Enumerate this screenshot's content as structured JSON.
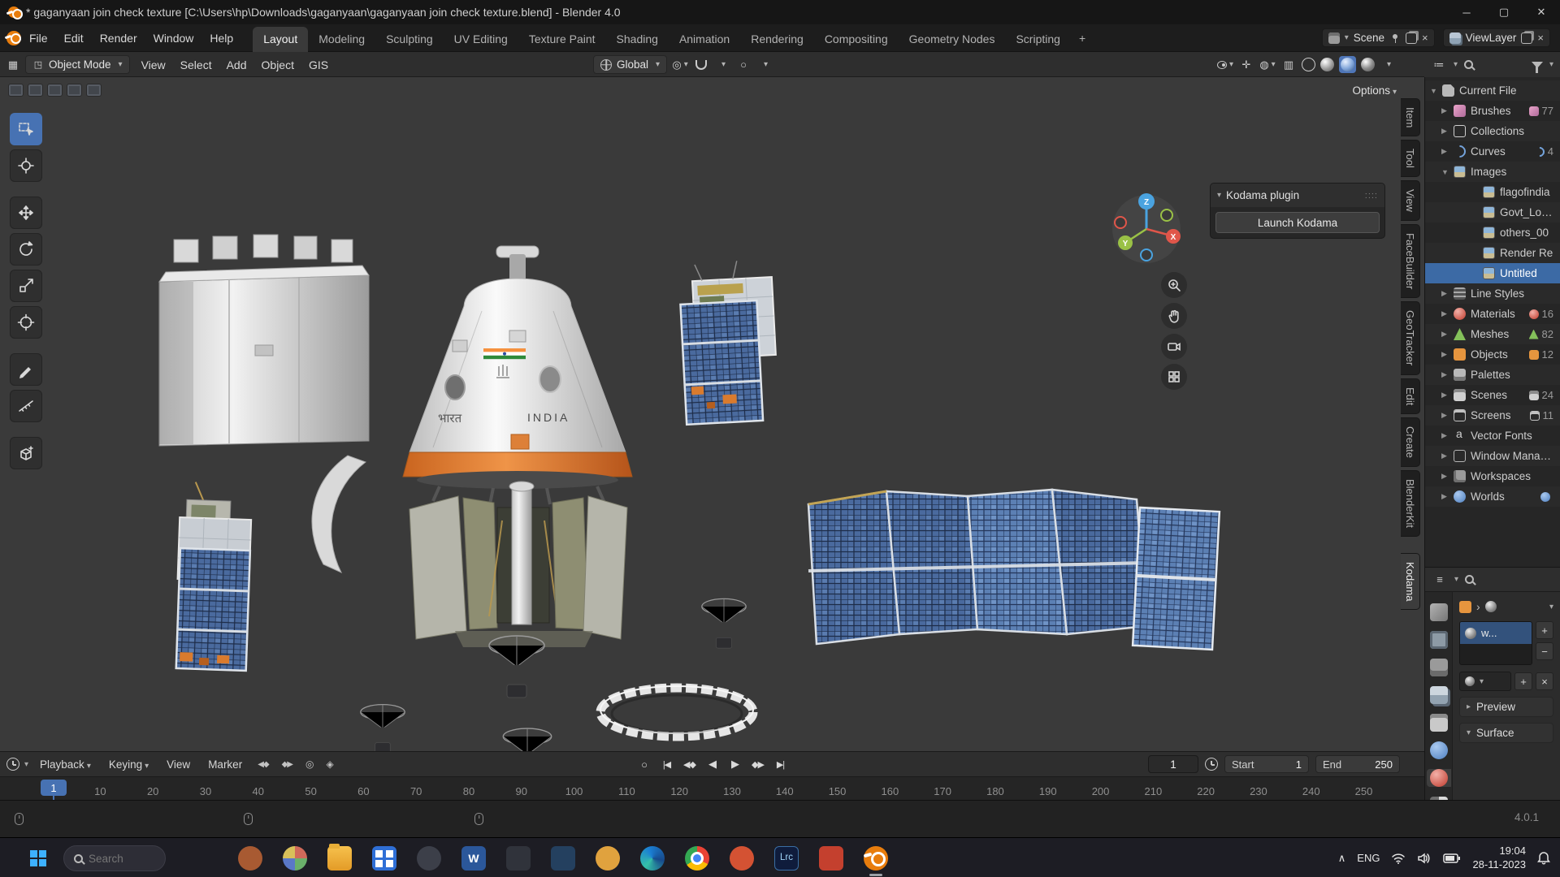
{
  "window": {
    "title": "* gaganyaan join check texture [C:\\Users\\hp\\Downloads\\gaganyaan\\gaganyaan join check texture.blend] - Blender 4.0"
  },
  "menubar": {
    "menus": [
      "File",
      "Edit",
      "Render",
      "Window",
      "Help"
    ],
    "workspaces": [
      {
        "label": "Layout",
        "state": "active"
      },
      {
        "label": "Modeling"
      },
      {
        "label": "Sculpting"
      },
      {
        "label": "UV Editing"
      },
      {
        "label": "Texture Paint"
      },
      {
        "label": "Shading"
      },
      {
        "label": "Animation"
      },
      {
        "label": "Rendering"
      },
      {
        "label": "Compositing"
      },
      {
        "label": "Geometry Nodes"
      },
      {
        "label": "Scripting"
      }
    ],
    "add_tab": "+",
    "scene_label": "Scene",
    "viewlayer_label": "ViewLayer"
  },
  "toolheader": {
    "mode": "Object Mode",
    "menus": [
      "View",
      "Select",
      "Add",
      "Object",
      "GIS"
    ],
    "orientation": "Global",
    "options_label": "Options"
  },
  "viewport": {
    "capsule_hindi": "भारत",
    "capsule_english": "INDIA",
    "gizmo": {
      "x": "X",
      "y": "Y",
      "z": "Z"
    }
  },
  "sidebar": {
    "title": "Kodama plugin",
    "launch_button": "Launch Kodama",
    "tabs": [
      {
        "label": "Item"
      },
      {
        "label": "Tool"
      },
      {
        "label": "View"
      },
      {
        "label": "FaceBuilder"
      },
      {
        "label": "GeoTracker"
      },
      {
        "label": "Edit"
      },
      {
        "label": "Create"
      },
      {
        "label": "BlenderKit"
      },
      {
        "label": "Kodama",
        "state": "active"
      }
    ]
  },
  "outliner": {
    "rows": [
      {
        "depth": "d0",
        "arrow": "▼",
        "icon": "file",
        "label": "Current File",
        "badge": ""
      },
      {
        "depth": "d1",
        "arrow": "▶",
        "icon": "brush",
        "label": "Brushes",
        "badge_icon": "brush",
        "badge": "77"
      },
      {
        "depth": "d1",
        "arrow": "▶",
        "icon": "collection",
        "label": "Collections",
        "badge": ""
      },
      {
        "depth": "d1",
        "arrow": "▶",
        "icon": "curve",
        "label": "Curves",
        "badge_icon": "curve",
        "badge": "4"
      },
      {
        "depth": "d1",
        "arrow": "▼",
        "icon": "image",
        "label": "Images",
        "badge": ""
      },
      {
        "depth": "d2",
        "arrow": "",
        "icon": "image",
        "label": "flagofindia",
        "badge": ""
      },
      {
        "depth": "d2",
        "arrow": "",
        "icon": "image",
        "label": "Govt_Logo",
        "badge": ""
      },
      {
        "depth": "d2",
        "arrow": "",
        "icon": "image",
        "label": "others_00",
        "badge": ""
      },
      {
        "depth": "d2",
        "arrow": "",
        "icon": "image",
        "label": "Render Re",
        "badge": ""
      },
      {
        "depth": "d2",
        "arrow": "",
        "icon": "image",
        "label": "Untitled",
        "badge": "",
        "state": "selected"
      },
      {
        "depth": "d1",
        "arrow": "▶",
        "icon": "linestyle",
        "label": "Line Styles",
        "badge": ""
      },
      {
        "depth": "d1",
        "arrow": "▶",
        "icon": "material",
        "label": "Materials",
        "badge_icon": "material",
        "badge": "16"
      },
      {
        "depth": "d1",
        "arrow": "▶",
        "icon": "mesh",
        "label": "Meshes",
        "badge_icon": "mesh",
        "badge": "82"
      },
      {
        "depth": "d1",
        "arrow": "▶",
        "icon": "object",
        "label": "Objects",
        "badge_icon": "object",
        "badge": "12"
      },
      {
        "depth": "d1",
        "arrow": "▶",
        "icon": "palette",
        "label": "Palettes",
        "badge": ""
      },
      {
        "depth": "d1",
        "arrow": "▶",
        "icon": "scene",
        "label": "Scenes",
        "badge_icon": "scene",
        "badge": "24"
      },
      {
        "depth": "d1",
        "arrow": "▶",
        "icon": "screen",
        "label": "Screens",
        "badge_icon": "screen",
        "badge": "11"
      },
      {
        "depth": "d1",
        "arrow": "▶",
        "icon": "font",
        "label": "Vector Fonts",
        "badge": ""
      },
      {
        "depth": "d1",
        "arrow": "▶",
        "icon": "wm",
        "label": "Window Managers",
        "badge": ""
      },
      {
        "depth": "d1",
        "arrow": "▶",
        "icon": "workspace",
        "label": "Workspaces",
        "badge": ""
      },
      {
        "depth": "d1",
        "arrow": "▶",
        "icon": "world",
        "label": "Worlds",
        "badge_icon": "world",
        "badge": ""
      }
    ]
  },
  "properties": {
    "slot_name": "w...",
    "preview_label": "Preview",
    "surface_label": "Surface",
    "tabs": [
      {
        "icon": "tool"
      },
      {
        "icon": "render"
      },
      {
        "icon": "output"
      },
      {
        "icon": "viewlayer"
      },
      {
        "icon": "scene"
      },
      {
        "icon": "world"
      },
      {
        "icon": "material",
        "state": "active"
      },
      {
        "icon": "texture"
      }
    ]
  },
  "timeline": {
    "playback": "Playback",
    "keying": "Keying",
    "view": "View",
    "marker": "Marker",
    "current_frame": "1",
    "start_label": "Start",
    "start_value": "1",
    "end_label": "End",
    "end_value": "250",
    "marker_frame": "1",
    "ticks": [
      10,
      20,
      30,
      40,
      50,
      60,
      70,
      80,
      90,
      100,
      110,
      120,
      130,
      140,
      150,
      160,
      170,
      180,
      190,
      200,
      210,
      220,
      230,
      240,
      250
    ]
  },
  "statusbar": {
    "version": "4.0.1"
  },
  "taskbar": {
    "search_placeholder": "Search",
    "apps": [
      {
        "name": "browser-orb",
        "shape": "circle",
        "color": "#a85a32",
        "label": ""
      },
      {
        "name": "multi-color-orb",
        "shape": "multi",
        "label": ""
      },
      {
        "name": "file-explorer",
        "shape": "folder",
        "label": ""
      },
      {
        "name": "microsoft-store",
        "shape": "store",
        "label": ""
      },
      {
        "name": "dark-orb-app",
        "shape": "circle",
        "color": "#3c3f49",
        "label": ""
      },
      {
        "name": "word",
        "shape": "square",
        "color": "#2b579a",
        "label": "W"
      },
      {
        "name": "dark-square-app",
        "shape": "square",
        "color": "#30333b",
        "label": ""
      },
      {
        "name": "blue-square-app",
        "shape": "square",
        "color": "#24405f",
        "label": ""
      },
      {
        "name": "gold-orb-app",
        "shape": "circle",
        "color": "#e0a23e",
        "label": ""
      },
      {
        "name": "edge",
        "shape": "edge",
        "label": ""
      },
      {
        "name": "chrome",
        "shape": "chrome",
        "label": ""
      },
      {
        "name": "red-orb-app",
        "shape": "circle",
        "color": "#d45233",
        "label": ""
      },
      {
        "name": "lightroom-classic",
        "shape": "square",
        "color": "#0f1c3c",
        "label": "Lrc"
      },
      {
        "name": "red-square-app",
        "shape": "square",
        "color": "#c4402e",
        "label": ""
      },
      {
        "name": "blender",
        "shape": "blender",
        "state": "active",
        "label": ""
      }
    ],
    "tray": {
      "lang": "ENG",
      "time": "19:04",
      "date": "28-11-2023"
    }
  }
}
